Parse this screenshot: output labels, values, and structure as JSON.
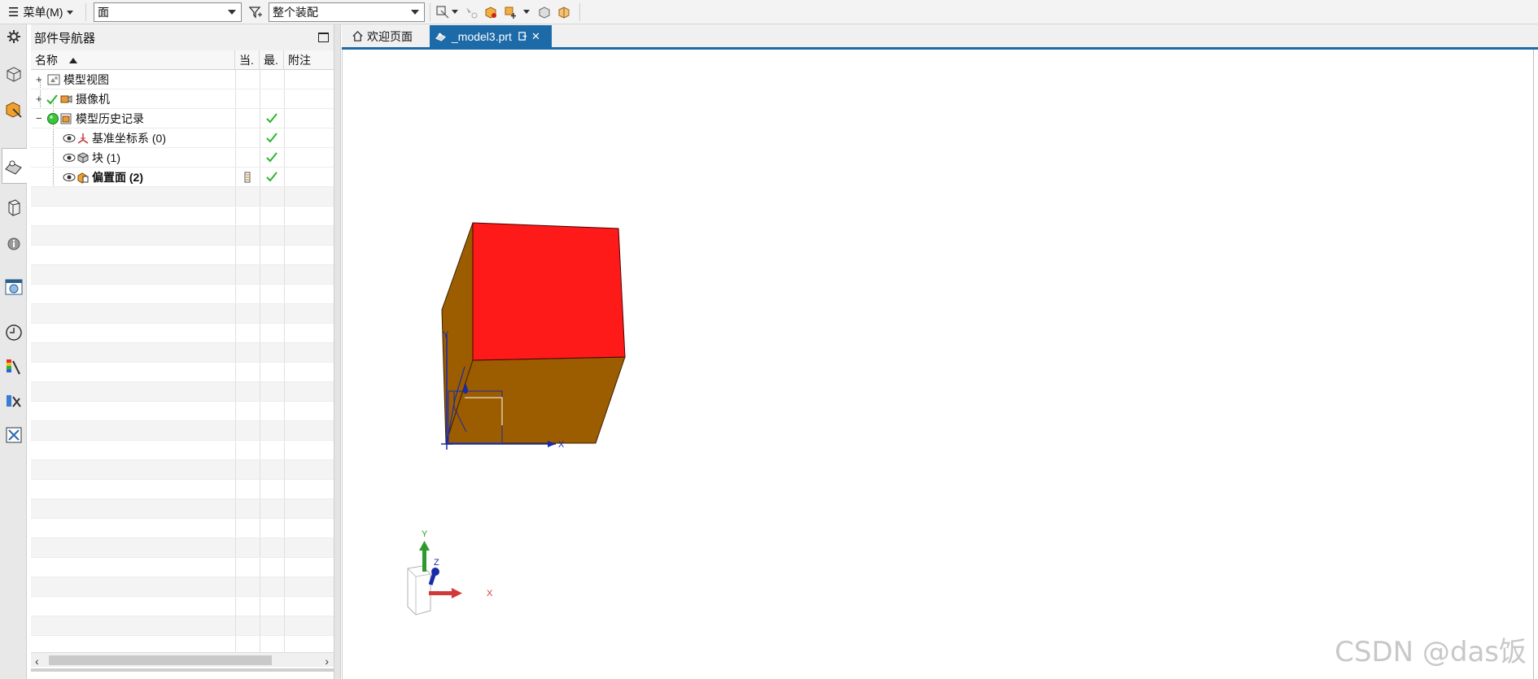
{
  "toolbar": {
    "menu_label": "菜单(M)",
    "filter_combo_value": "面",
    "scope_combo_value": "整个装配"
  },
  "navigator": {
    "title": "部件导航器",
    "columns": {
      "name": "名称",
      "current": "当.",
      "latest": "最.",
      "notes": "附注"
    },
    "rows": [
      {
        "label": "模型视图",
        "expanded": false,
        "latest_check": false
      },
      {
        "label": "摄像机",
        "expanded": false,
        "latest_check": false
      },
      {
        "label": "模型历史记录",
        "expanded": true,
        "latest_check": true
      },
      {
        "label": "基准坐标系 (0)",
        "latest_check": true
      },
      {
        "label": "块 (1)",
        "latest_check": true
      },
      {
        "label": "偏置面 (2)",
        "latest_check": true,
        "bold": true
      }
    ]
  },
  "tabs": [
    {
      "label": "欢迎页面",
      "active": false
    },
    {
      "label": "_model3.prt",
      "active": true
    }
  ],
  "viewport": {
    "triad_labels": {
      "x": "X",
      "y": "Y",
      "z": "Z"
    },
    "datum_labels": {
      "x": "X",
      "y": "Y"
    },
    "colors": {
      "top_face": "#ff1a1a",
      "side_faces": "#9c5c00",
      "accent": "#1c6aa8"
    }
  },
  "watermark": "CSDN @das饭"
}
